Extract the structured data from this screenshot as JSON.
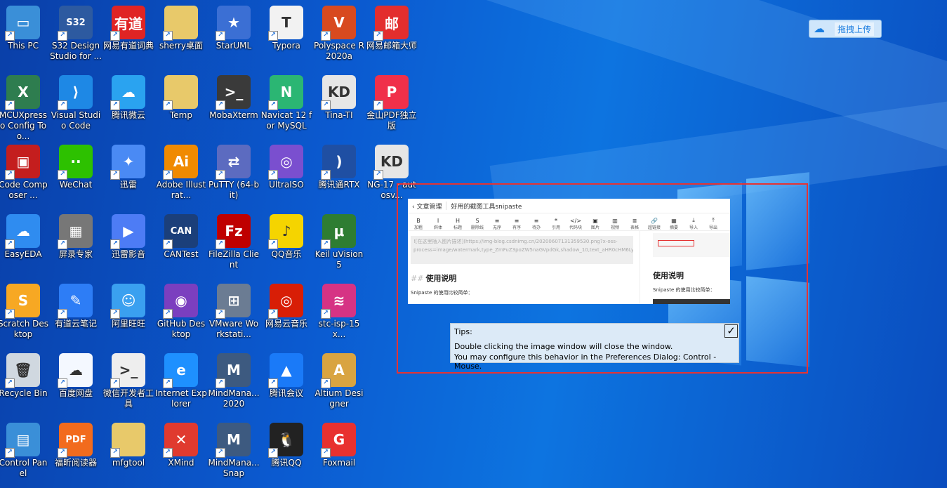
{
  "desktop": {
    "icons": [
      {
        "label": "This PC",
        "icon": "computer-icon",
        "color": "#3a8fd8",
        "glyph": "▭"
      },
      {
        "label": "S32 Design Studio for ...",
        "icon": "s32ds-icon",
        "color": "#2d5aa0",
        "glyph": "S32"
      },
      {
        "label": "网易有道词典",
        "icon": "youdao-dict-icon",
        "color": "#e02424",
        "glyph": "有道"
      },
      {
        "label": "sherry桌面",
        "icon": "folder-icon",
        "color": "#e8c96a",
        "glyph": ""
      },
      {
        "label": "StarUML",
        "icon": "staruml-icon",
        "color": "#3b6fd4",
        "glyph": "★"
      },
      {
        "label": "Typora",
        "icon": "typora-icon",
        "color": "#f2f2f2",
        "glyph": "T"
      },
      {
        "label": "Polyspace R2020a",
        "icon": "polyspace-icon",
        "color": "#d84a1f",
        "glyph": "V"
      },
      {
        "label": "网易邮箱大师",
        "icon": "netease-mail-icon",
        "color": "#e32e2e",
        "glyph": "邮"
      },
      {
        "label": "MCUXpresso Config Too...",
        "icon": "mcuxpresso-icon",
        "color": "#2e7d4f",
        "glyph": "X"
      },
      {
        "label": "Visual Studio Code",
        "icon": "vscode-icon",
        "color": "#1e88e5",
        "glyph": "⟩"
      },
      {
        "label": "腾讯微云",
        "icon": "weiyun-icon",
        "color": "#2aa3f0",
        "glyph": "☁"
      },
      {
        "label": "Temp",
        "icon": "folder-icon",
        "color": "#e8c96a",
        "glyph": ""
      },
      {
        "label": "MobaXterm",
        "icon": "mobaxterm-icon",
        "color": "#3a3a3a",
        "glyph": ">_"
      },
      {
        "label": "Navicat 12 for MySQL",
        "icon": "navicat-icon",
        "color": "#2bb673",
        "glyph": "N"
      },
      {
        "label": "Tina-TI",
        "icon": "tina-ti-icon",
        "color": "#e6e6e6",
        "glyph": "KD"
      },
      {
        "label": "金山PDF独立版",
        "icon": "wps-pdf-icon",
        "color": "#f0304a",
        "glyph": "P"
      },
      {
        "label": "Code Composer ...",
        "icon": "ccs-icon",
        "color": "#c41e1e",
        "glyph": "▣"
      },
      {
        "label": "WeChat",
        "icon": "wechat-icon",
        "color": "#2dc100",
        "glyph": "··"
      },
      {
        "label": "迅雷",
        "icon": "xunlei-icon",
        "color": "#4a8af4",
        "glyph": "✦"
      },
      {
        "label": "Adobe Illustrat...",
        "icon": "illustrator-icon",
        "color": "#f08a00",
        "glyph": "Ai"
      },
      {
        "label": "PuTTY (64-bit)",
        "icon": "putty-icon",
        "color": "#5c6bc0",
        "glyph": "⇄"
      },
      {
        "label": "UltraISO",
        "icon": "ultraiso-icon",
        "color": "#7a4fcf",
        "glyph": "◎"
      },
      {
        "label": "腾讯通RTX",
        "icon": "rtx-icon",
        "color": "#1f4fa3",
        "glyph": ")"
      },
      {
        "label": "NG-17 - autosv...",
        "icon": "ng17-icon",
        "color": "#e6e6e6",
        "glyph": "KD"
      },
      {
        "label": "EasyEDA",
        "icon": "easyeda-icon",
        "color": "#2f8cf0",
        "glyph": "☁"
      },
      {
        "label": "屏录专家",
        "icon": "screen-record-icon",
        "color": "#777777",
        "glyph": "▦"
      },
      {
        "label": "迅雷影音",
        "icon": "xunlei-video-icon",
        "color": "#4d7cf5",
        "glyph": "▶"
      },
      {
        "label": "CANTest",
        "icon": "cantest-icon",
        "color": "#1b3f7a",
        "glyph": "CAN"
      },
      {
        "label": "FileZilla Client",
        "icon": "filezilla-icon",
        "color": "#bf0000",
        "glyph": "Fz"
      },
      {
        "label": "QQ音乐",
        "icon": "qqmusic-icon",
        "color": "#f5d400",
        "glyph": "♪"
      },
      {
        "label": "Keil uVision5",
        "icon": "keil-icon",
        "color": "#2e7d32",
        "glyph": "μ"
      },
      {
        "label": "Scratch Desktop",
        "icon": "scratch-icon",
        "color": "#f7a823",
        "glyph": "S"
      },
      {
        "label": "有道云笔记",
        "icon": "youdao-note-icon",
        "color": "#2d7df6",
        "glyph": "✎"
      },
      {
        "label": "阿里旺旺",
        "icon": "aliwangwang-icon",
        "color": "#3aa0f0",
        "glyph": "☺"
      },
      {
        "label": "GitHub Desktop",
        "icon": "github-icon",
        "color": "#7b3fbf",
        "glyph": "◉"
      },
      {
        "label": "VMware Workstati...",
        "icon": "vmware-icon",
        "color": "#6b7c93",
        "glyph": "⊞"
      },
      {
        "label": "网易云音乐",
        "icon": "netease-music-icon",
        "color": "#d81e06",
        "glyph": "◎"
      },
      {
        "label": "stc-isp-15x...",
        "icon": "stc-isp-icon",
        "color": "#d63384",
        "glyph": "≋"
      },
      {
        "label": "Recycle Bin",
        "icon": "recycle-bin-icon",
        "color": "#d0d8e0",
        "glyph": "🗑"
      },
      {
        "label": "百度网盘",
        "icon": "baidu-netdisk-icon",
        "color": "#f4f8ff",
        "glyph": "☁"
      },
      {
        "label": "微信开发者工具",
        "icon": "wechat-devtools-icon",
        "color": "#eeeeee",
        "glyph": ">_"
      },
      {
        "label": "Internet Explorer",
        "icon": "ie-icon",
        "color": "#1e90ff",
        "glyph": "e"
      },
      {
        "label": "MindMana... 2020",
        "icon": "mindmanager-icon",
        "color": "#3d5a80",
        "glyph": "M"
      },
      {
        "label": "腾讯会议",
        "icon": "tencent-meeting-icon",
        "color": "#1a7af8",
        "glyph": "▲"
      },
      {
        "label": "Altium Designer",
        "icon": "altium-icon",
        "color": "#d9a441",
        "glyph": "A"
      },
      {
        "label": "Control Panel",
        "icon": "control-panel-icon",
        "color": "#3a8fd8",
        "glyph": "▤"
      },
      {
        "label": "福昕阅读器",
        "icon": "foxit-icon",
        "color": "#f26b1d",
        "glyph": "PDF"
      },
      {
        "label": "mfgtool",
        "icon": "folder-icon",
        "color": "#e8c96a",
        "glyph": ""
      },
      {
        "label": "XMind",
        "icon": "xmind-icon",
        "color": "#e03a2f",
        "glyph": "✕"
      },
      {
        "label": "MindMana... Snap",
        "icon": "mindmanager-snap-icon",
        "color": "#3d5a80",
        "glyph": "M"
      },
      {
        "label": "腾讯QQ",
        "icon": "qq-icon",
        "color": "#222222",
        "glyph": "🐧"
      },
      {
        "label": "Foxmail",
        "icon": "foxmail-icon",
        "color": "#e8312f",
        "glyph": "G"
      }
    ]
  },
  "upload": {
    "label": "拖拽上传"
  },
  "snip": {
    "back_label": "文章管理",
    "doc_title": "好用的截图工具snipaste",
    "toolbar": [
      "B",
      "I",
      "H",
      "S",
      "≡",
      "≡",
      "≡",
      "❝",
      "</>",
      "▣",
      "▥",
      "≣",
      "🔗",
      "▦",
      "⤓",
      "⤒"
    ],
    "toolbar_labels": [
      "加粗",
      "斜体",
      "标题",
      "删除线",
      "无序",
      "有序",
      "待办",
      "引用",
      "代码块",
      "图片",
      "视频",
      "表格",
      "超链接",
      "摘要",
      "导入",
      "导出"
    ],
    "code_text": "![在这里插入图片描述](https://img-blog.csdnimg.cn/20200607131359530.png?x-oss-process=image/watermark,type_ZmFuZ3poZW5naGVpdGk,shadow_10,text_aHR0cHM6Ly9ibG9nLmNzZG4ubmV0L2ZiaW1lbmcxMTY=,size_16,color_FFFFFF,t_70)",
    "heading_mark": "##",
    "heading": "使用说明",
    "para": "Snipaste 的使用比较简单：",
    "right_heading": "使用说明",
    "right_para": "Snipaste 的使用比较简单："
  },
  "tips": {
    "title": "Tips:",
    "line1": "Double clicking the image window will close the window.",
    "line2": "You may configure this behavior in the Preferences Dialog: Control - Mouse.",
    "check": "✓"
  }
}
